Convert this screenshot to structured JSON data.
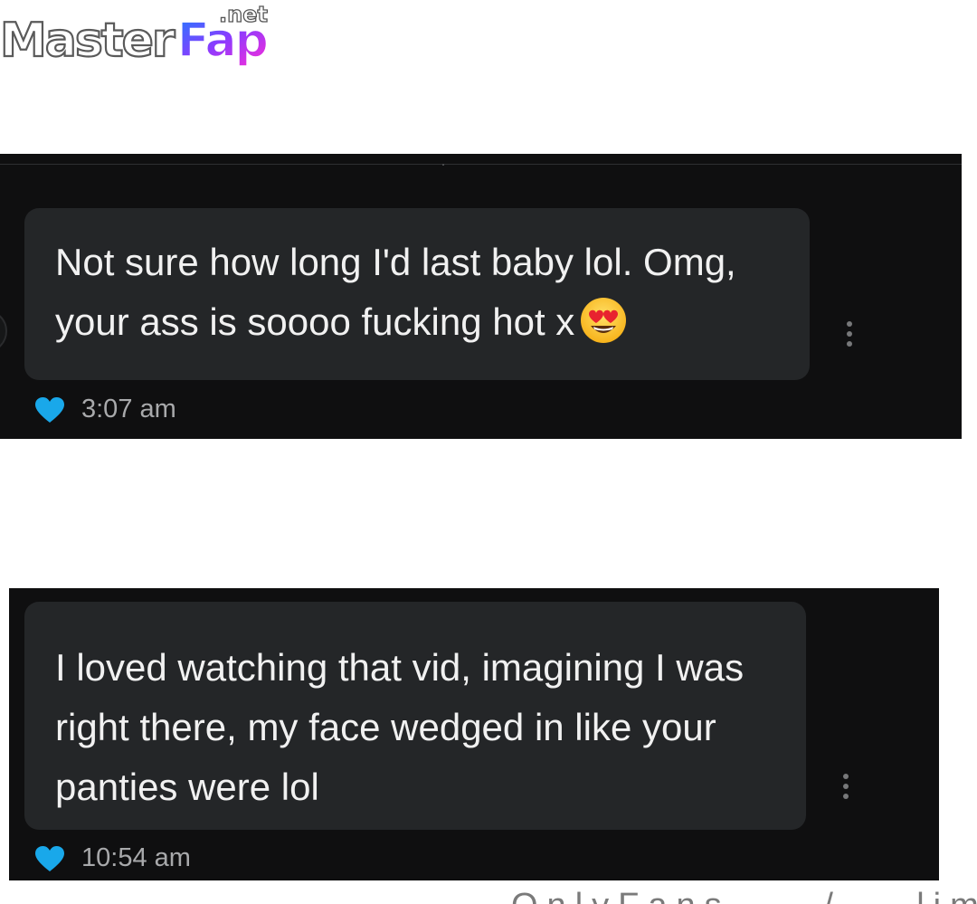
{
  "logo": {
    "text_master": "MasterFap",
    "text_tld": ".net"
  },
  "messages": [
    {
      "text": "Not sure how long I'd last baby lol. Omg, your ass is soooo fucking hot x",
      "emoji": "heart-eyes-emoji",
      "time": "3:07 am",
      "liked": true
    },
    {
      "text": "I loved watching that vid, imagining I was right there, my face wedged in like your panties were lol",
      "time": "10:54 am",
      "liked": true
    }
  ],
  "footer": {
    "partial_text": "OnlyFans ... /... limit"
  },
  "colors": {
    "panel_bg": "#0f0f10",
    "bubble_bg": "#242628",
    "message_text": "#f1f1f1",
    "heart": "#19a8ea",
    "timestamp": "#a8a9ab"
  }
}
